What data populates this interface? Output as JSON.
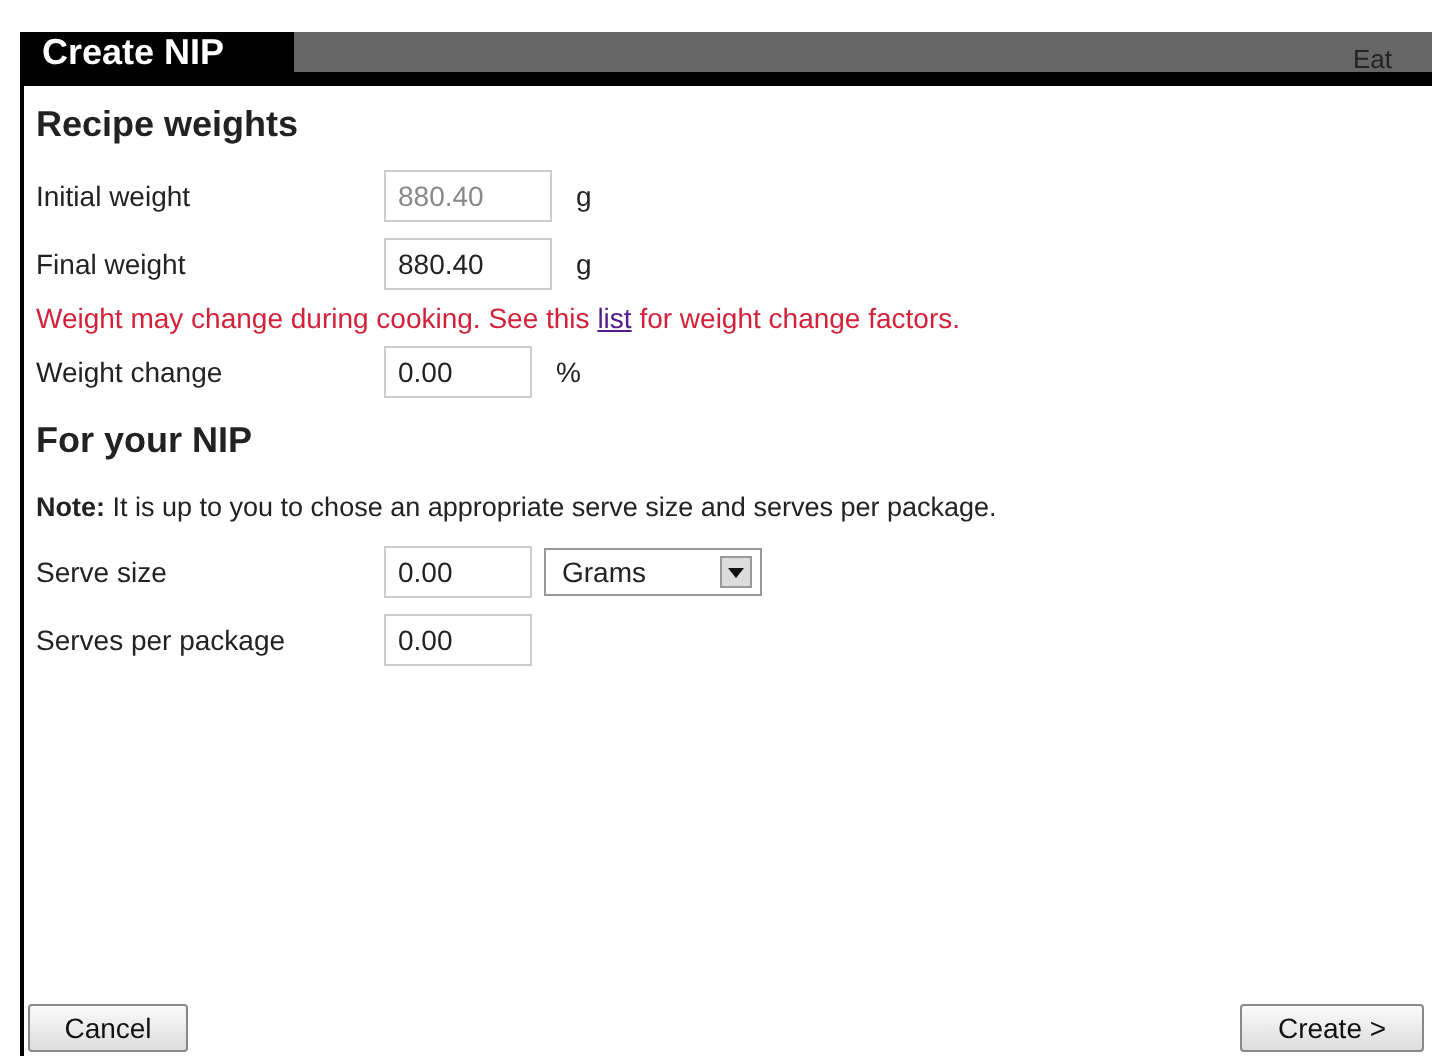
{
  "dialog": {
    "title": "Create NIP",
    "background_text": "Eat"
  },
  "recipe_weights": {
    "heading": "Recipe weights",
    "fields": [
      {
        "label": "Initial weight",
        "value": "880.40",
        "unit": "g",
        "disabled": true
      },
      {
        "label": "Final weight",
        "value": "880.40",
        "unit": "g",
        "disabled": false
      }
    ],
    "warning": {
      "before": "Weight may change during cooking. See this ",
      "link": "list",
      "after": " for weight change factors."
    },
    "change": {
      "label": "Weight change",
      "value": "0.00",
      "unit": "%",
      "disabled": false
    }
  },
  "nip": {
    "heading": "For your NIP",
    "note": "**Note:** It is up to you to chose an appropriate serve size and serves per package.",
    "serve_size": {
      "label": "Serve size",
      "value": "0.00",
      "unit": "Grams"
    },
    "serves_per_package": {
      "label": "Serves per package",
      "value": "0.00"
    }
  },
  "buttons": {
    "cancel": "Cancel",
    "create": "Create >"
  }
}
